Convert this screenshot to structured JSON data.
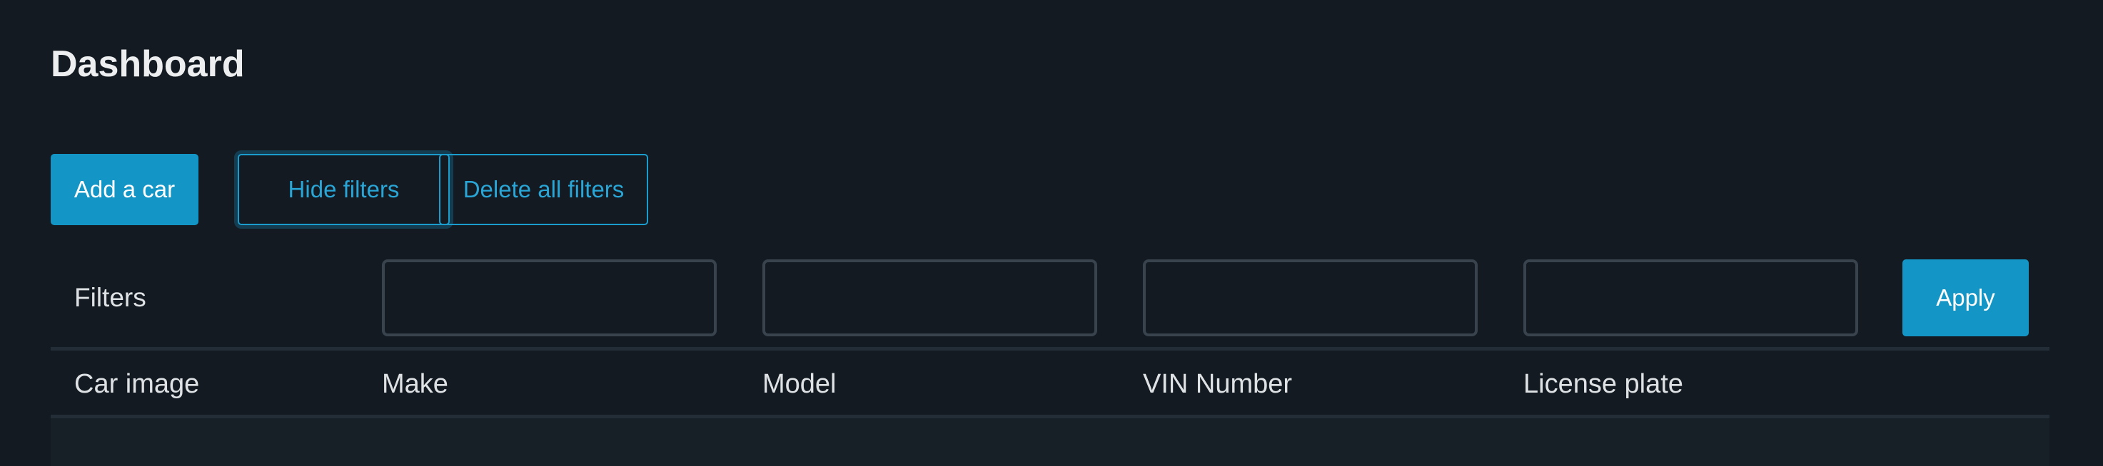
{
  "header": {
    "title": "Dashboard"
  },
  "actions": {
    "add_car_label": "Add a car",
    "hide_filters_label": "Hide filters",
    "delete_filters_label": "Delete all filters"
  },
  "filters": {
    "label": "Filters",
    "make": {
      "value": "",
      "placeholder": ""
    },
    "model": {
      "value": "",
      "placeholder": ""
    },
    "vin": {
      "value": "",
      "placeholder": ""
    },
    "plate": {
      "value": "",
      "placeholder": ""
    },
    "apply_label": "Apply"
  },
  "table": {
    "columns": [
      "Car image",
      "Make",
      "Model",
      "VIN Number",
      "License plate"
    ],
    "rows": []
  },
  "colors": {
    "background": "#131a22",
    "accent": "#1396c6",
    "input_border": "#38434e",
    "text": "#e6e8ea"
  }
}
